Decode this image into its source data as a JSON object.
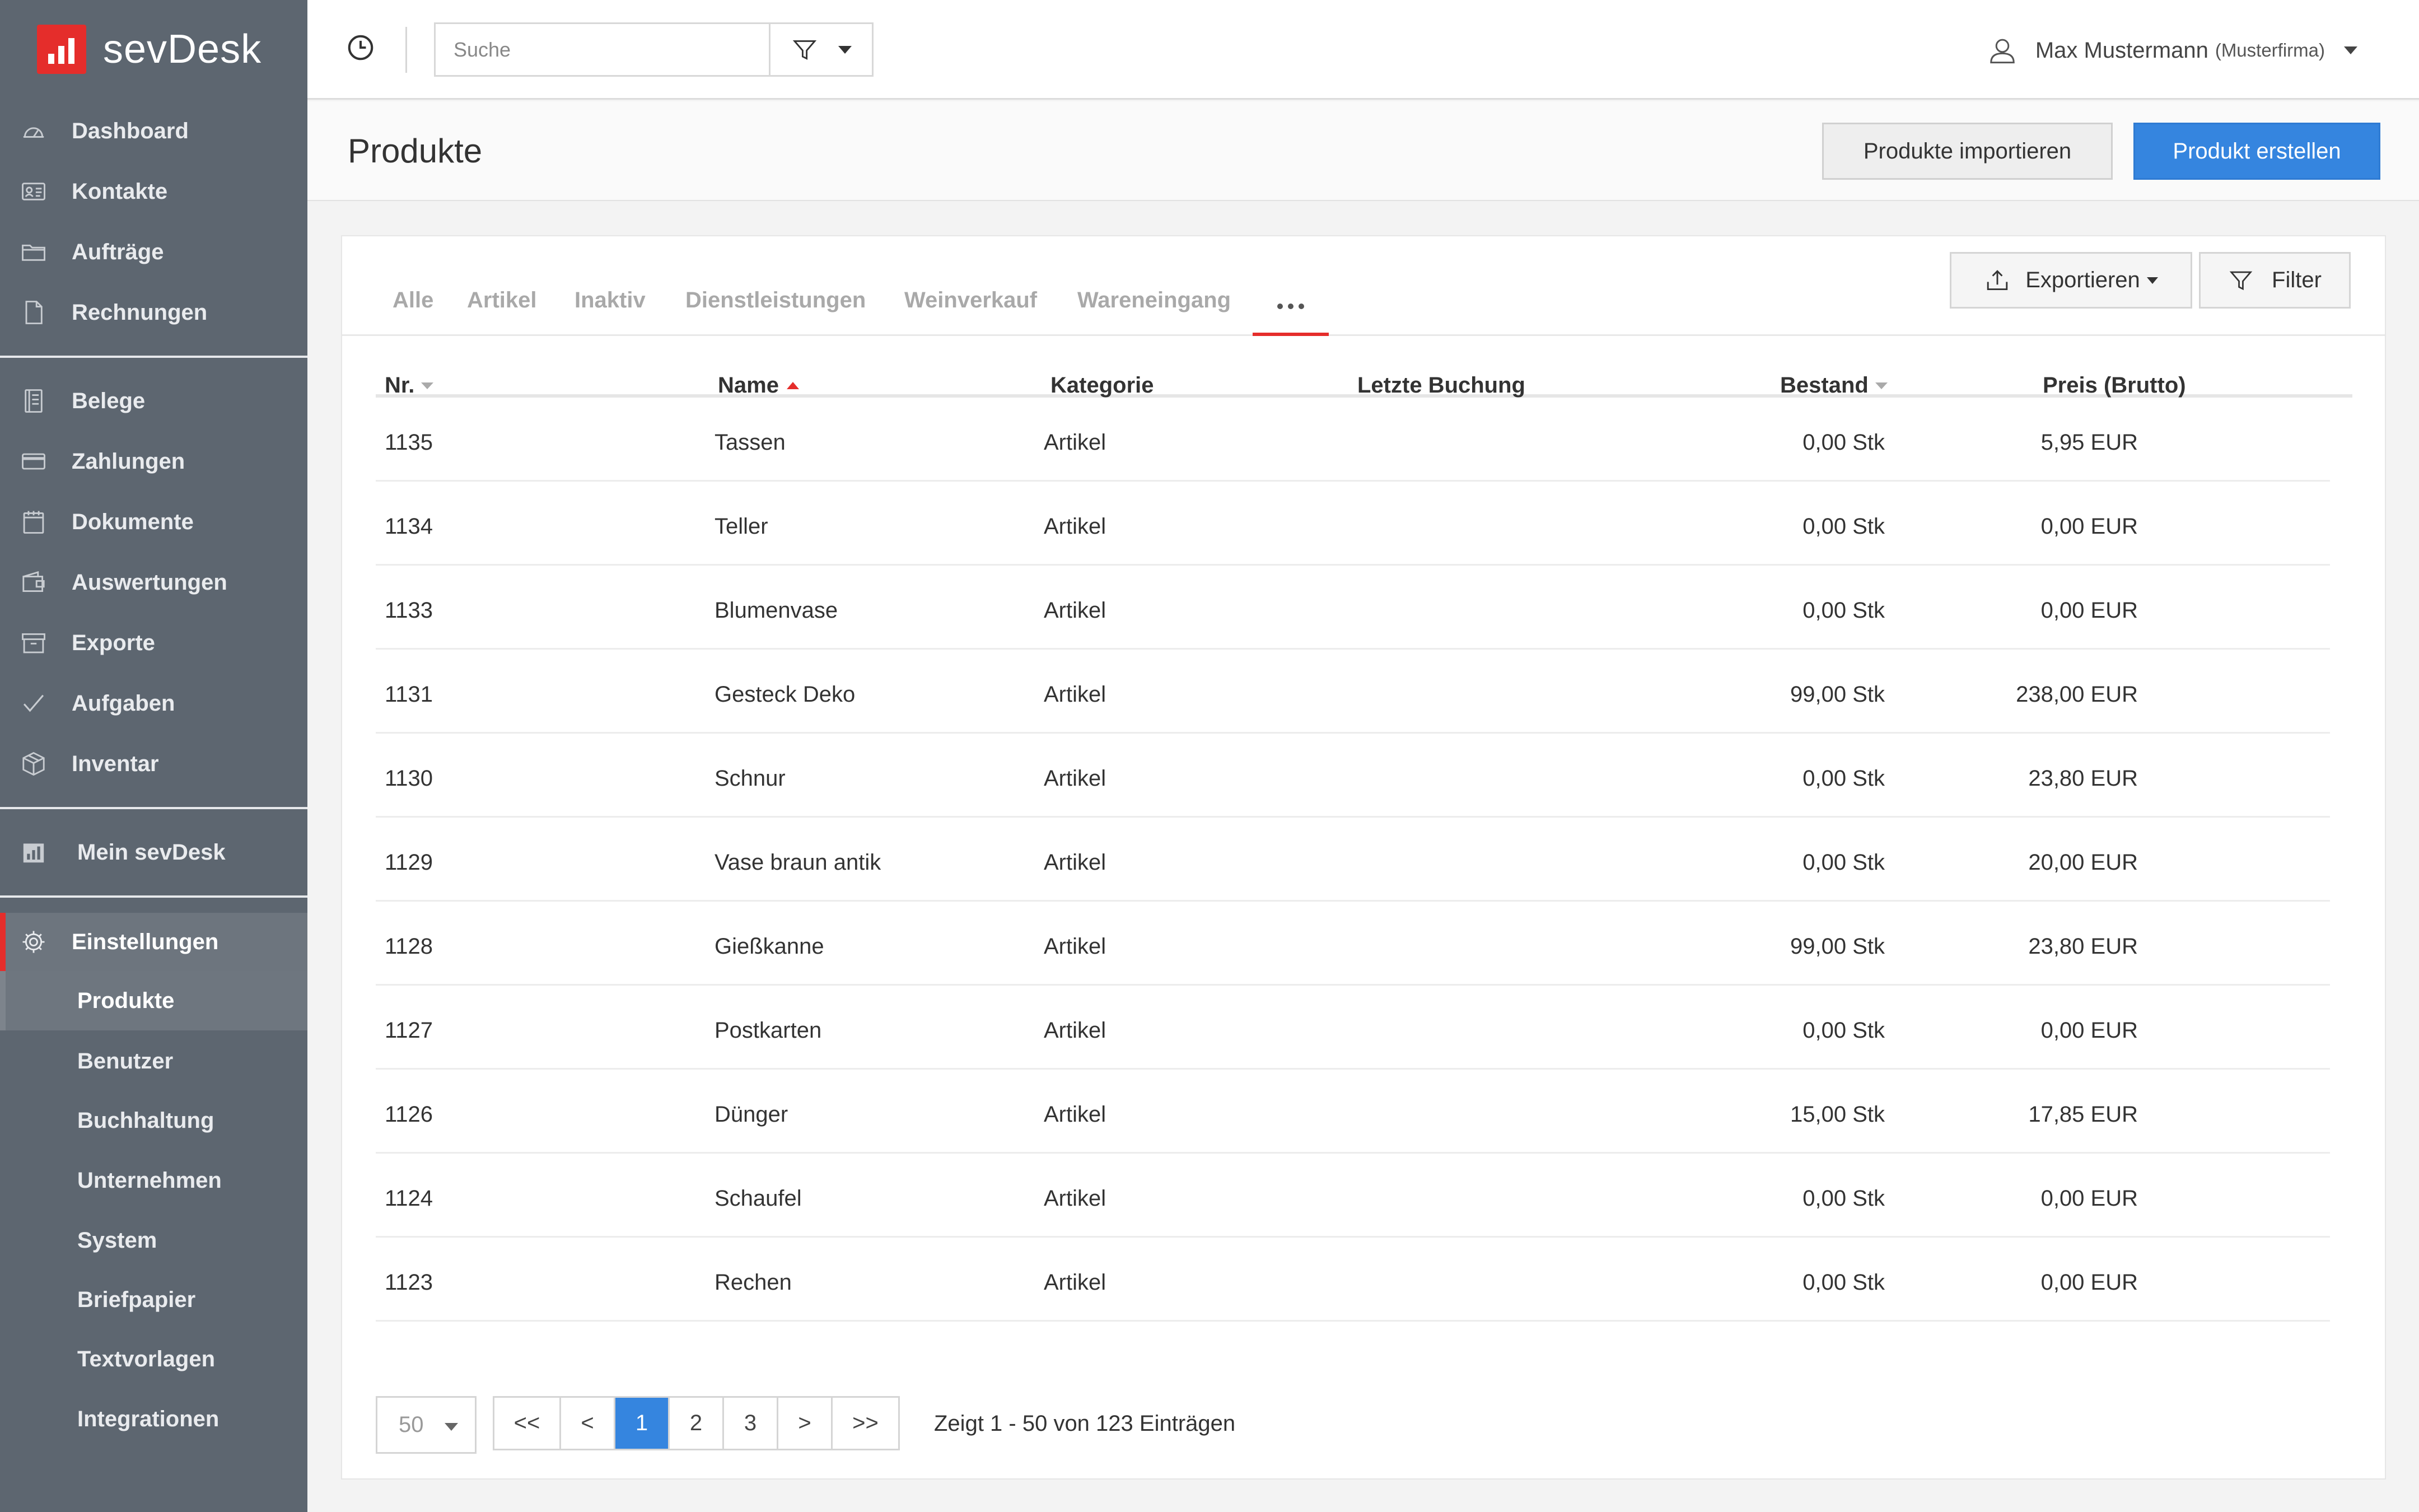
{
  "app": {
    "name": "sevDesk",
    "brand_color": "#e52d2b",
    "accent_color": "#3585df"
  },
  "sidebar": {
    "main_items": [
      {
        "label": "Dashboard",
        "icon": "cloud-gauge-icon"
      },
      {
        "label": "Kontakte",
        "icon": "contact-card-icon"
      },
      {
        "label": "Aufträge",
        "icon": "folder-icon"
      },
      {
        "label": "Rechnungen",
        "icon": "document-icon"
      }
    ],
    "finance_items": [
      {
        "label": "Belege",
        "icon": "receipt-icon"
      },
      {
        "label": "Zahlungen",
        "icon": "credit-card-icon"
      },
      {
        "label": "Dokumente",
        "icon": "calendar-document-icon"
      },
      {
        "label": "Auswertungen",
        "icon": "wallet-icon"
      },
      {
        "label": "Exporte",
        "icon": "archive-box-icon"
      },
      {
        "label": "Aufgaben",
        "icon": "checkmark-icon"
      },
      {
        "label": "Inventar",
        "icon": "box-icon"
      }
    ],
    "mein": {
      "label": "Mein sevDesk",
      "icon": "bar-chart-icon"
    },
    "settings": {
      "label": "Einstellungen",
      "icon": "gear-icon",
      "subitems": [
        "Produkte",
        "Benutzer",
        "Buchhaltung",
        "Unternehmen",
        "System",
        "Briefpapier",
        "Textvorlagen",
        "Integrationen"
      ],
      "current": "Produkte"
    }
  },
  "topbar": {
    "search_placeholder": "Suche",
    "user_name": "Max Mustermann",
    "company": "(Musterfirma)"
  },
  "page": {
    "title": "Produkte",
    "import_label": "Produkte importieren",
    "create_label": "Produkt erstellen"
  },
  "tabs": [
    "Alle",
    "Artikel",
    "Inaktiv",
    "Dienstleistungen",
    "Weinverkauf",
    "Wareneingang"
  ],
  "actions": {
    "export_label": "Exportieren",
    "filter_label": "Filter"
  },
  "table": {
    "headers": {
      "nr": "Nr.",
      "name": "Name",
      "category": "Kategorie",
      "last_booking": "Letzte Buchung",
      "stock": "Bestand",
      "price": "Preis (Brutto)"
    },
    "rows": [
      {
        "nr": "1135",
        "name": "Tassen",
        "category": "Artikel",
        "last_booking": "",
        "stock": "0,00 Stk",
        "price": "5,95 EUR"
      },
      {
        "nr": "1134",
        "name": "Teller",
        "category": "Artikel",
        "last_booking": "",
        "stock": "0,00 Stk",
        "price": "0,00 EUR"
      },
      {
        "nr": "1133",
        "name": "Blumenvase",
        "category": "Artikel",
        "last_booking": "",
        "stock": "0,00 Stk",
        "price": "0,00 EUR"
      },
      {
        "nr": "1131",
        "name": "Gesteck Deko",
        "category": "Artikel",
        "last_booking": "",
        "stock": "99,00 Stk",
        "price": "238,00 EUR"
      },
      {
        "nr": "1130",
        "name": "Schnur",
        "category": "Artikel",
        "last_booking": "",
        "stock": "0,00 Stk",
        "price": "23,80 EUR"
      },
      {
        "nr": "1129",
        "name": "Vase braun antik",
        "category": "Artikel",
        "last_booking": "",
        "stock": "0,00 Stk",
        "price": "20,00 EUR"
      },
      {
        "nr": "1128",
        "name": "Gießkanne",
        "category": "Artikel",
        "last_booking": "",
        "stock": "99,00 Stk",
        "price": "23,80 EUR"
      },
      {
        "nr": "1127",
        "name": "Postkarten",
        "category": "Artikel",
        "last_booking": "",
        "stock": "0,00 Stk",
        "price": "0,00 EUR"
      },
      {
        "nr": "1126",
        "name": "Dünger",
        "category": "Artikel",
        "last_booking": "",
        "stock": "15,00 Stk",
        "price": "17,85 EUR"
      },
      {
        "nr": "1124",
        "name": "Schaufel",
        "category": "Artikel",
        "last_booking": "",
        "stock": "0,00 Stk",
        "price": "0,00 EUR"
      },
      {
        "nr": "1123",
        "name": "Rechen",
        "category": "Artikel",
        "last_booking": "",
        "stock": "0,00 Stk",
        "price": "0,00 EUR"
      }
    ]
  },
  "pagination": {
    "per_page": "50",
    "first": "<<",
    "prev": "<",
    "pages": [
      "1",
      "2",
      "3"
    ],
    "current_page": "1",
    "next": ">",
    "last": ">>",
    "info": "Zeigt 1 - 50 von 123 Einträgen"
  }
}
